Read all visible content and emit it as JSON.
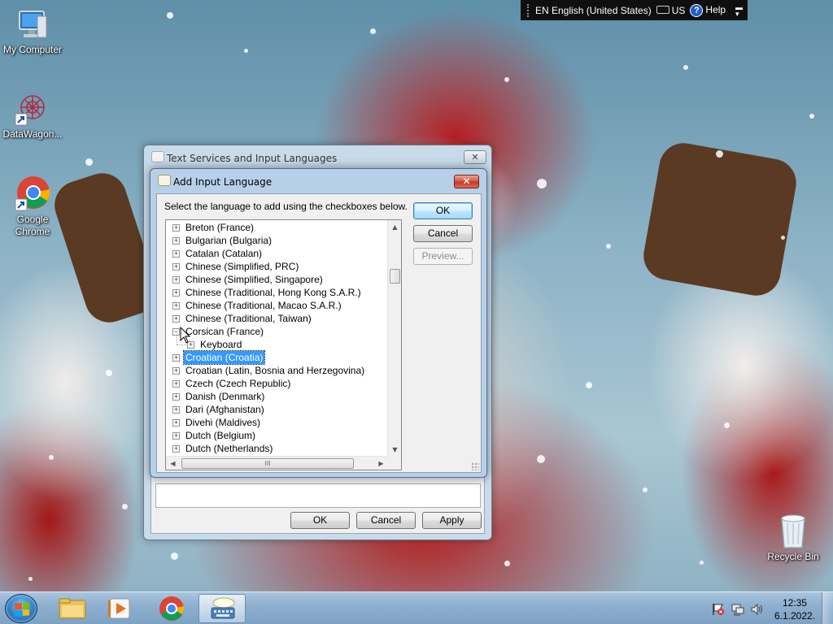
{
  "language_bar": {
    "language": "EN English (United States)",
    "keyboard": "US",
    "help": "Help"
  },
  "desktop": {
    "icons": [
      {
        "label": "My Computer"
      },
      {
        "label": "DataWagon..."
      },
      {
        "label": "Google Chrome"
      },
      {
        "label": "Recycle Bin"
      }
    ]
  },
  "back_dialog": {
    "title": "Text Services and Input Languages",
    "close": "✕",
    "ok_label": "OK",
    "cancel_label": "Cancel",
    "apply_label": "Apply"
  },
  "add_dialog": {
    "title": "Add Input Language",
    "close": "✕",
    "prompt": "Select the language to add using the checkboxes below.",
    "ok_label": "OK",
    "cancel_label": "Cancel",
    "preview_label": "Preview...",
    "tree": [
      {
        "label": "Breton (France)",
        "expanded": false
      },
      {
        "label": "Bulgarian (Bulgaria)",
        "expanded": false
      },
      {
        "label": "Catalan (Catalan)",
        "expanded": false
      },
      {
        "label": "Chinese (Simplified, PRC)",
        "expanded": false
      },
      {
        "label": "Chinese (Simplified, Singapore)",
        "expanded": false
      },
      {
        "label": "Chinese (Traditional, Hong Kong S.A.R.)",
        "expanded": false
      },
      {
        "label": "Chinese (Traditional, Macao S.A.R.)",
        "expanded": false
      },
      {
        "label": "Chinese (Traditional, Taiwan)",
        "expanded": false
      },
      {
        "label": "Corsican (France)",
        "expanded": true
      },
      {
        "label": "Keyboard",
        "child": true
      },
      {
        "label": "Croatian (Croatia)",
        "selected": true
      },
      {
        "label": "Croatian (Latin, Bosnia and Herzegovina)"
      },
      {
        "label": "Czech (Czech Republic)"
      },
      {
        "label": "Danish (Denmark)"
      },
      {
        "label": "Dari (Afghanistan)"
      },
      {
        "label": "Divehi (Maldives)"
      },
      {
        "label": "Dutch (Belgium)"
      },
      {
        "label": "Dutch (Netherlands)"
      }
    ],
    "hscroll_grip": "III"
  },
  "taskbar": {
    "time": "12:35",
    "date": "6.1.2022."
  },
  "colors": {
    "selection": "#3399ff",
    "taskbar": "#8fb0cf",
    "close_red": "#c23a22"
  }
}
